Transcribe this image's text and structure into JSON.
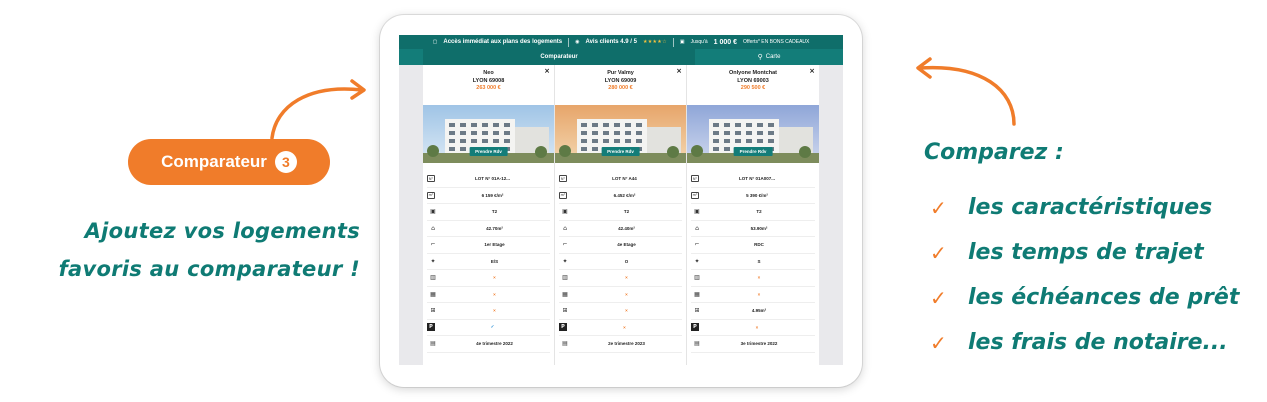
{
  "left": {
    "pill_label": "Comparateur",
    "pill_number": "3",
    "line1": "Ajoutez vos logements",
    "line2": "favoris au comparateur !"
  },
  "right": {
    "title": "Comparez :",
    "items": [
      "les caractéristiques",
      "les temps de trajet",
      "les échéances de prêt",
      "les frais de notaire..."
    ]
  },
  "topbar": {
    "plans": "Accès immédiat aux plans des logements",
    "avis": "Avis clients 4.9 / 5",
    "stars": "★★★★☆",
    "offer_prefix": "Jusqu'à",
    "offer_amount": "1 000 €",
    "offer_suffix": "Offerts* EN BONS CADEAUX"
  },
  "nav": {
    "comparateur": "Comparateur",
    "carte": "Carte"
  },
  "button_label": "Prendre Rdv",
  "close_glyph": "×",
  "icons": [
    "N°",
    "m²",
    "▣",
    "⌂",
    "⌐",
    "✦",
    "▥",
    "▦",
    "⊞",
    "P",
    "▤"
  ],
  "columns": [
    {
      "name": "Neo",
      "city": "LYON 69008",
      "price": "263 000 €",
      "values": [
        "LOT N° 01A-12...",
        "6 159 €/m²",
        "T2",
        "42.70m²",
        "1er Etage",
        "E/S",
        "×",
        "×",
        "×",
        "✓",
        "4e trimestre 2022"
      ]
    },
    {
      "name": "Pur Valmy",
      "city": "LYON 69009",
      "price": "280 000 €",
      "values": [
        "LOT N° A44",
        "6.452 €/m²",
        "T2",
        "42.40m²",
        "4e Etage",
        "O",
        "×",
        "×",
        "×",
        "×",
        "2e trimestre 2023"
      ]
    },
    {
      "name": "Onlyone Montchat",
      "city": "LYON 69003",
      "price": "290 500 €",
      "values": [
        "LOT N° 01A007...",
        "5 390 €/m²",
        "T2",
        "53.90m²",
        "RDC",
        "S",
        "×",
        "×",
        "4.95m²",
        "×",
        "3e trimestre 2022"
      ]
    }
  ],
  "colors": {
    "teal": "#0f7b74",
    "orange": "#f07c2a",
    "nav": "#137d79"
  }
}
